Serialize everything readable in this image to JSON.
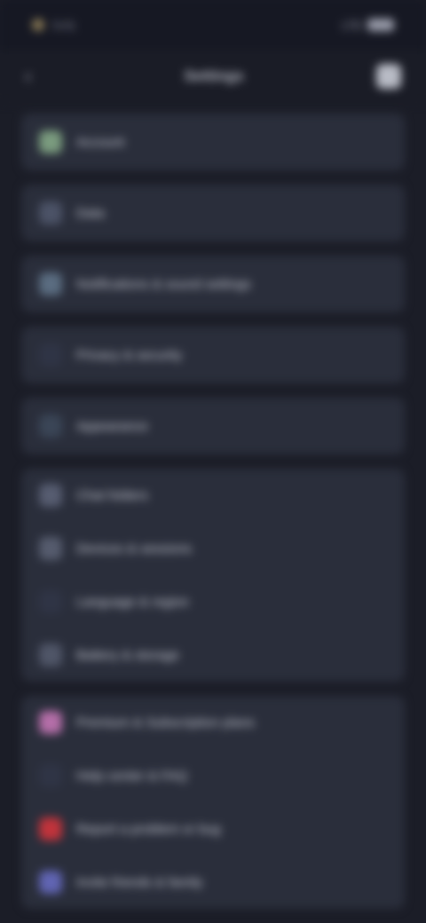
{
  "status": {
    "time": "9:41",
    "signal": "LTE"
  },
  "header": {
    "title": "Settings",
    "back_label": "‹"
  },
  "groups": [
    {
      "items": [
        {
          "label": "Account",
          "icon": "user-icon",
          "color": "#7a9b7e"
        }
      ]
    },
    {
      "items": [
        {
          "label": "Data",
          "icon": "database-icon",
          "color": "#4b5266"
        }
      ]
    },
    {
      "items": [
        {
          "label": "Notifications & sound settings",
          "icon": "bell-icon",
          "color": "#5a6c80"
        }
      ]
    },
    {
      "items": [
        {
          "label": "Privacy & security",
          "icon": "lock-icon",
          "color": "#2f3445"
        }
      ]
    },
    {
      "items": [
        {
          "label": "Appearance",
          "icon": "palette-icon",
          "color": "#3a4556"
        }
      ]
    },
    {
      "items": [
        {
          "label": "Chat folders",
          "icon": "folder-icon",
          "color": "#565c70"
        },
        {
          "label": "Devices & sessions",
          "icon": "devices-icon",
          "color": "#555b6d"
        },
        {
          "label": "Language & region",
          "icon": "globe-icon",
          "color": "#2f3445"
        },
        {
          "label": "Battery & storage",
          "icon": "battery-icon",
          "color": "#4f5567"
        }
      ]
    },
    {
      "items": [
        {
          "label": "Premium & Subscription plans",
          "icon": "star-icon",
          "color": "#b46ea8"
        },
        {
          "label": "Help center & FAQ",
          "icon": "help-icon",
          "color": "#2f3445"
        },
        {
          "label": "Report a problem or bug",
          "icon": "alert-icon",
          "color": "#c0333b"
        },
        {
          "label": "Invite friends & family",
          "icon": "invite-icon",
          "color": "#6064b2"
        }
      ]
    }
  ]
}
